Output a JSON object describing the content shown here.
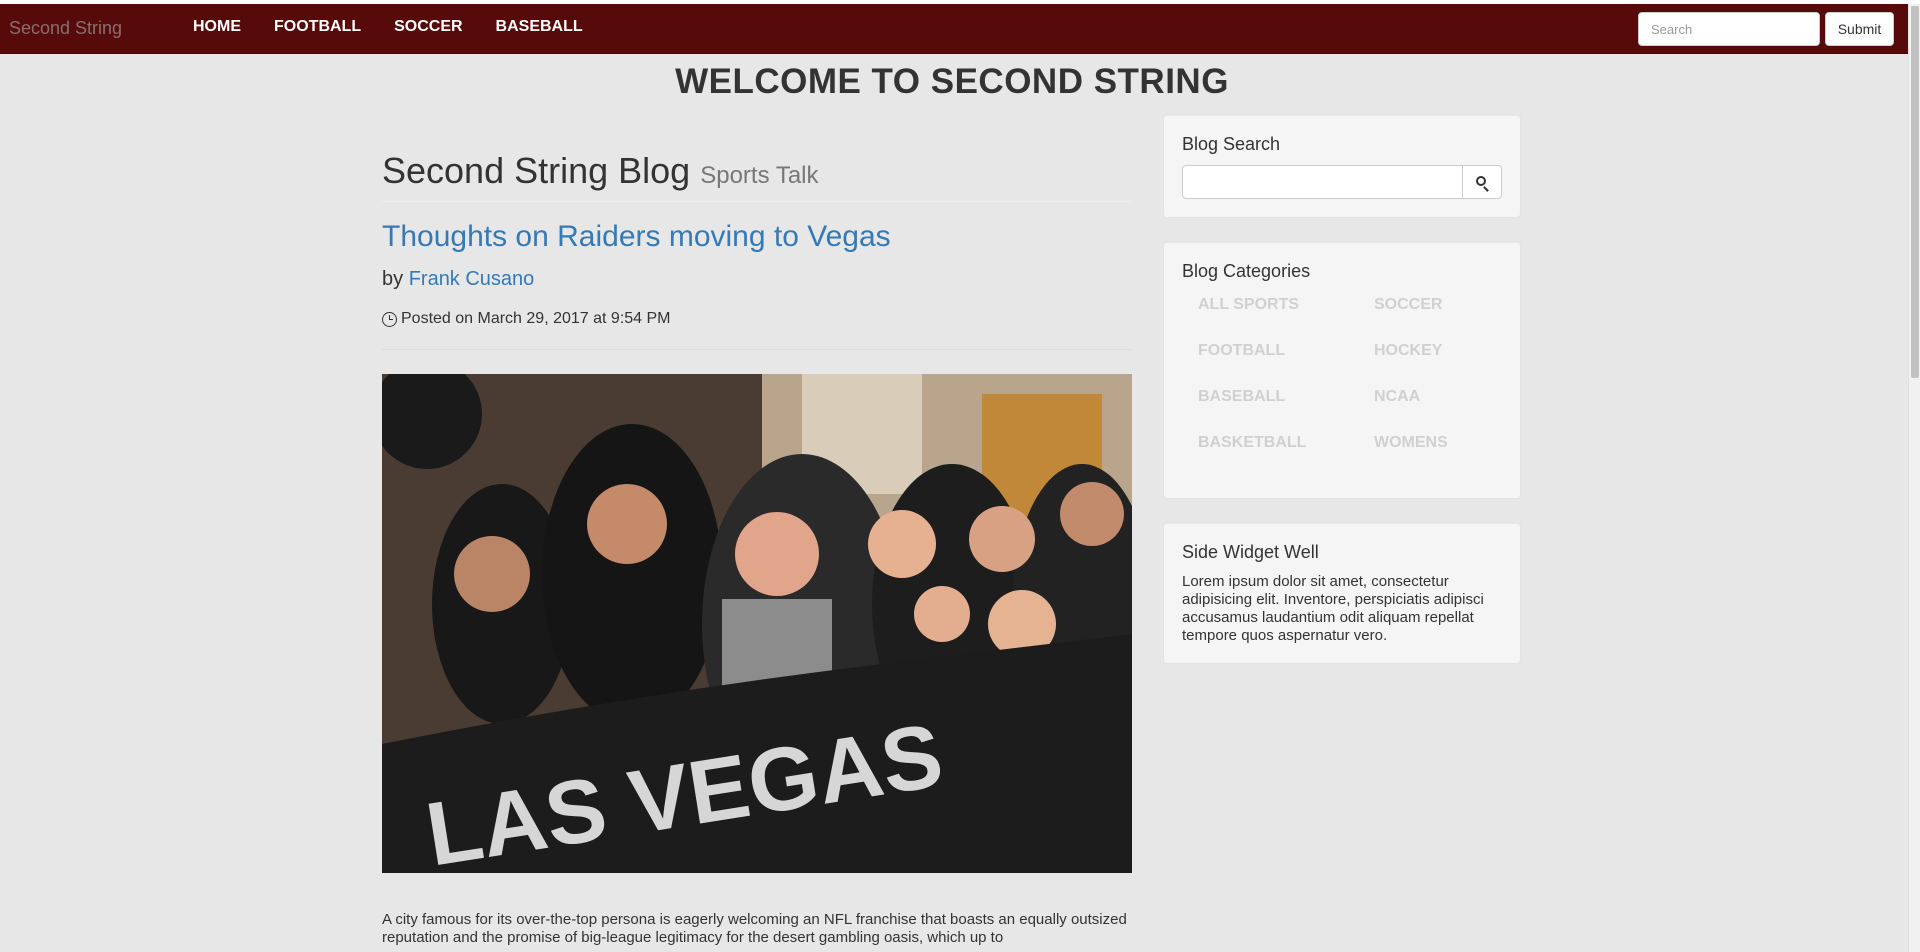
{
  "navbar": {
    "brand": "Second String",
    "links": [
      "HOME",
      "FOOTBALL",
      "SOCCER",
      "BASEBALL"
    ],
    "search_placeholder": "Search",
    "submit_label": "Submit"
  },
  "welcome": "WELCOME TO SECOND STRING",
  "main": {
    "blog_title": "Second String Blog",
    "blog_subtitle": "Sports Talk",
    "post_title": "Thoughts on Raiders moving to Vegas",
    "by_prefix": "by",
    "author": "Frank Cusano",
    "posted_text": "Posted on March 29, 2017 at 9:54 PM",
    "image_banner_text": "LAS VEGAS",
    "excerpt": "A city famous for its over-the-top persona is eagerly welcoming an NFL franchise that boasts an equally outsized reputation and the promise of big-league legitimacy for the desert gambling oasis, which up to"
  },
  "sidebar": {
    "search_title": "Blog Search",
    "categories_title": "Blog Categories",
    "categories": [
      "ALL SPORTS",
      "SOCCER",
      "FOOTBALL",
      "HOCKEY",
      "BASEBALL",
      "NCAA",
      "BASKETBALL",
      "WOMENS"
    ],
    "widget_title": "Side Widget Well",
    "widget_text": "Lorem ipsum dolor sit amet, consectetur adipisicing elit. Inventore, perspiciatis adipisci accusamus laudantium odit aliquam repellat tempore quos aspernatur vero."
  },
  "colors": {
    "navbar_bg": "#560a09",
    "link_blue": "#337ab7",
    "page_bg": "#e7e7e7"
  }
}
